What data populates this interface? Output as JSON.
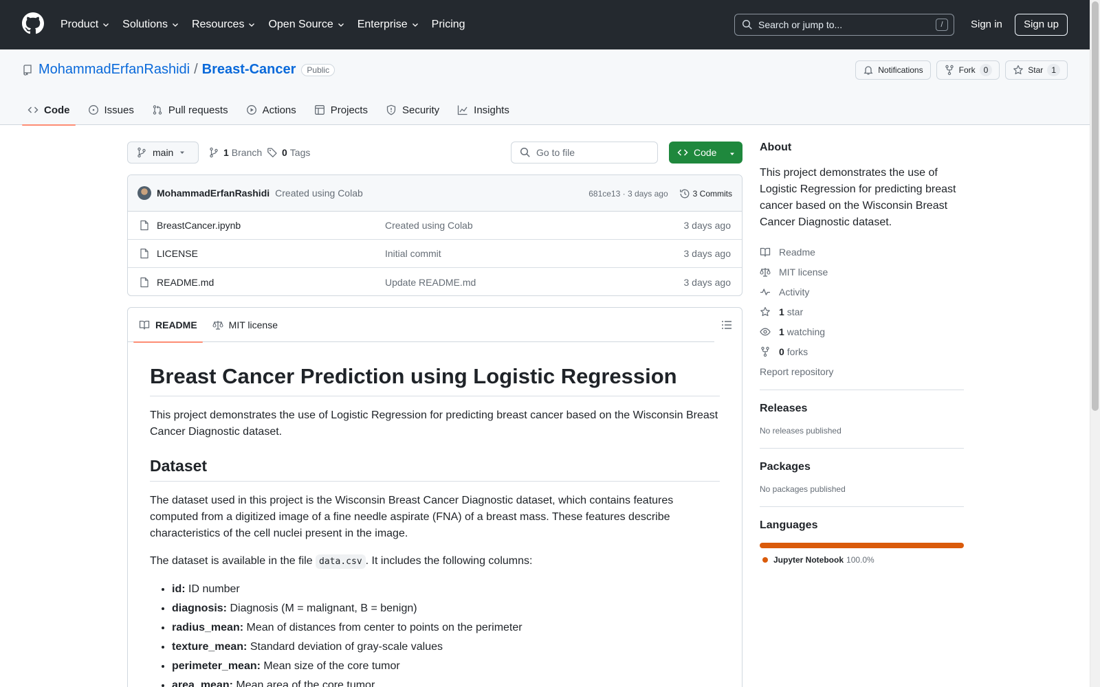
{
  "header": {
    "nav": [
      "Product",
      "Solutions",
      "Resources",
      "Open Source",
      "Enterprise",
      "Pricing"
    ],
    "search_placeholder": "Search or jump to...",
    "search_key": "/",
    "signin": "Sign in",
    "signup": "Sign up"
  },
  "repo": {
    "owner": "MohammadErfanRashidi",
    "separator": "/",
    "name": "Breast-Cancer",
    "visibility": "Public",
    "notifications_label": "Notifications",
    "fork_label": "Fork",
    "fork_count": "0",
    "star_label": "Star",
    "star_count": "1"
  },
  "tabs": [
    {
      "label": "Code",
      "icon": "code-icon",
      "active": true
    },
    {
      "label": "Issues",
      "icon": "issue-icon"
    },
    {
      "label": "Pull requests",
      "icon": "pull-request-icon"
    },
    {
      "label": "Actions",
      "icon": "play-icon"
    },
    {
      "label": "Projects",
      "icon": "table-icon"
    },
    {
      "label": "Security",
      "icon": "shield-icon"
    },
    {
      "label": "Insights",
      "icon": "graph-icon"
    }
  ],
  "branch_bar": {
    "branch": "main",
    "branch_count": "1",
    "branch_label": "Branch",
    "tag_count": "0",
    "tag_label": "Tags",
    "goto_placeholder": "Go to file",
    "code_button": "Code"
  },
  "commit": {
    "author": "MohammadErfanRashidi",
    "message": "Created using Colab",
    "hash_age": "681ce13 · 3 days ago",
    "commits_label": "3 Commits"
  },
  "files": [
    {
      "name": "BreastCancer.ipynb",
      "message": "Created using Colab",
      "age": "3 days ago"
    },
    {
      "name": "LICENSE",
      "message": "Initial commit",
      "age": "3 days ago"
    },
    {
      "name": "README.md",
      "message": "Update README.md",
      "age": "3 days ago"
    }
  ],
  "readme": {
    "tab_readme": "README",
    "tab_license": "MIT license",
    "title": "Breast Cancer Prediction using Logistic Regression",
    "intro": "This project demonstrates the use of Logistic Regression for predicting breast cancer based on the Wisconsin Breast Cancer Diagnostic dataset.",
    "dataset_heading": "Dataset",
    "dataset_p1": "The dataset used in this project is the Wisconsin Breast Cancer Diagnostic dataset, which contains features computed from a digitized image of a fine needle aspirate (FNA) of a breast mass. These features describe characteristics of the cell nuclei present in the image.",
    "dataset_p2_before": "The dataset is available in the file ",
    "dataset_p2_code": "data.csv",
    "dataset_p2_after": ". It includes the following columns:",
    "columns": [
      {
        "key": "id:",
        "desc": " ID number"
      },
      {
        "key": "diagnosis:",
        "desc": " Diagnosis (M = malignant, B = benign)"
      },
      {
        "key": "radius_mean:",
        "desc": " Mean of distances from center to points on the perimeter"
      },
      {
        "key": "texture_mean:",
        "desc": " Standard deviation of gray-scale values"
      },
      {
        "key": "perimeter_mean:",
        "desc": " Mean size of the core tumor"
      },
      {
        "key": "area_mean:",
        "desc": " Mean area of the core tumor"
      }
    ]
  },
  "sidebar": {
    "about_heading": "About",
    "about_desc": "This project demonstrates the use of Logistic Regression for predicting breast cancer based on the Wisconsin Breast Cancer Diagnostic dataset.",
    "readme": "Readme",
    "license": "MIT license",
    "activity": "Activity",
    "stars_count": "1",
    "stars_label": "star",
    "watching_count": "1",
    "watching_label": "watching",
    "forks_count": "0",
    "forks_label": "forks",
    "report": "Report repository",
    "releases_heading": "Releases",
    "releases_text": "No releases published",
    "packages_heading": "Packages",
    "packages_text": "No packages published",
    "languages_heading": "Languages",
    "language_name": "Jupyter Notebook",
    "language_pct": "100.0%",
    "language_color": "#DA5B0B",
    "language_fraction": 1.0
  }
}
